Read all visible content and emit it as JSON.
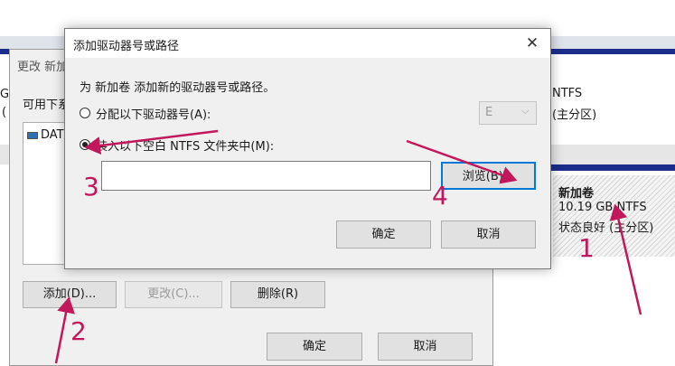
{
  "background": {
    "top_left_fragments": [
      "GB",
      "("
    ],
    "right_panel_top": {
      "fs": "NTFS",
      "kind": "(主分区)"
    },
    "right_panel_volume": {
      "name": "新加卷",
      "size": "10.19 GB NTFS",
      "status": "状态良好 (主分区)"
    }
  },
  "change_dialog": {
    "title_fragment": "更改 新加",
    "available_label_fragment": "可用下系",
    "list_item": "DAT",
    "buttons": {
      "add": "添加(D)...",
      "change": "更改(C)...",
      "delete": "删除(R)"
    },
    "ok": "确定",
    "cancel": "取消"
  },
  "add_dialog": {
    "title": "添加驱动器号或路径",
    "close_glyph": "✕",
    "description": "为 新加卷 添加新的驱动器号或路径。",
    "option_letter": "分配以下驱动器号(A):",
    "option_folder": "装入以下空白 NTFS 文件夹中(M):",
    "selected_letter": "E",
    "folder_path": "",
    "browse": "浏览(B)...",
    "ok": "确定",
    "cancel": "取消"
  },
  "annotations": {
    "n1": "1",
    "n2": "2",
    "n3": "3",
    "n4": "4",
    "color": "#c2185b"
  }
}
